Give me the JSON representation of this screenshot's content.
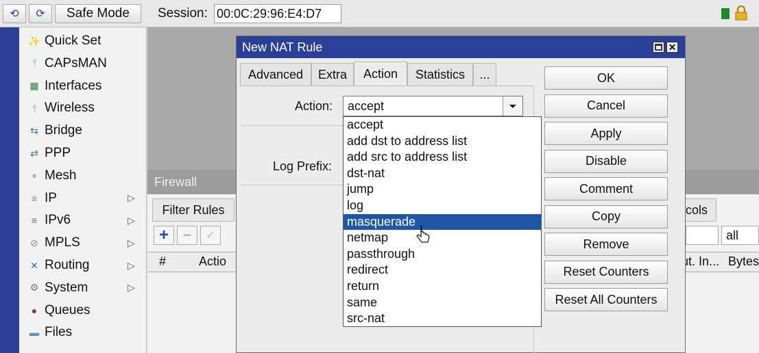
{
  "toolbar": {
    "undo_icon": "undo-icon",
    "redo_icon": "redo-icon",
    "safe_mode": "Safe Mode",
    "session_label": "Session:",
    "session_value": "00:0C:29:96:E4:D7"
  },
  "sidebar": {
    "items": [
      {
        "label": "Quick Set",
        "icon": "wand-icon",
        "submenu": false
      },
      {
        "label": "CAPsMAN",
        "icon": "antenna-icon",
        "submenu": false
      },
      {
        "label": "Interfaces",
        "icon": "interfaces-icon",
        "submenu": false
      },
      {
        "label": "Wireless",
        "icon": "antenna-icon",
        "submenu": false
      },
      {
        "label": "Bridge",
        "icon": "bridge-icon",
        "submenu": false
      },
      {
        "label": "PPP",
        "icon": "ppp-icon",
        "submenu": false
      },
      {
        "label": "Mesh",
        "icon": "mesh-icon",
        "submenu": false
      },
      {
        "label": "IP",
        "icon": "ip-icon",
        "submenu": true
      },
      {
        "label": "IPv6",
        "icon": "ipv6-icon",
        "submenu": true
      },
      {
        "label": "MPLS",
        "icon": "mpls-icon",
        "submenu": true
      },
      {
        "label": "Routing",
        "icon": "routing-icon",
        "submenu": true
      },
      {
        "label": "System",
        "icon": "gear-icon",
        "submenu": true
      },
      {
        "label": "Queues",
        "icon": "queues-icon",
        "submenu": false
      },
      {
        "label": "Files",
        "icon": "folder-icon",
        "submenu": false
      }
    ]
  },
  "firewall": {
    "title": "Firewall",
    "tab_filter_rules": "Filter Rules",
    "tab_protocols_partial": "ocols",
    "filter_value": "all",
    "col_hash": "#",
    "col_action": "Actio",
    "col_out_in": "ut. In...",
    "col_bytes": "Bytes"
  },
  "dialog": {
    "title": "New NAT Rule",
    "tabs": [
      "Advanced",
      "Extra",
      "Action",
      "Statistics",
      "..."
    ],
    "action_label": "Action:",
    "action_value": "accept",
    "log_prefix_label": "Log Prefix:",
    "dropdown_options": [
      "accept",
      "add dst to address list",
      "add src to address list",
      "dst-nat",
      "jump",
      "log",
      "masquerade",
      "netmap",
      "passthrough",
      "redirect",
      "return",
      "same",
      "src-nat"
    ],
    "highlighted_option": "masquerade",
    "buttons": [
      "OK",
      "Cancel",
      "Apply",
      "Disable",
      "Comment",
      "Copy",
      "Remove",
      "Reset Counters",
      "Reset All Counters"
    ]
  },
  "colors": {
    "title_blue": "#2a3f97",
    "highlight_blue": "#1f57a8",
    "sidebar_strip": "#2c3f97"
  }
}
